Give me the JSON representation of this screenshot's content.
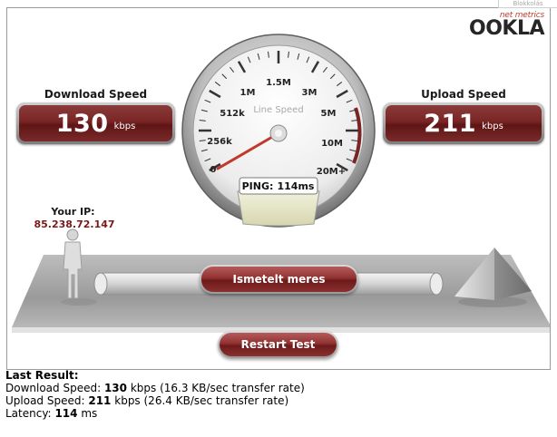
{
  "header": {
    "corner_link": "Blokkolás",
    "brand_top": "net metrics",
    "brand_main": "OOKLA"
  },
  "download": {
    "label": "Download Speed",
    "value": "130",
    "unit": "kbps"
  },
  "upload": {
    "label": "Upload Speed",
    "value": "211",
    "unit": "kbps"
  },
  "gauge": {
    "title": "Line Speed",
    "ticks": [
      "0",
      "256k",
      "512k",
      "1M",
      "1.5M",
      "3M",
      "5M",
      "10M",
      "20M+"
    ],
    "needle_value": "130 kbps",
    "ping_label": "PING:",
    "ping_value": "114ms"
  },
  "ip": {
    "label": "Your IP:",
    "value": "85.238.72.147"
  },
  "buttons": {
    "retest": "Ismetelt meres",
    "restart": "Restart Test"
  },
  "last_result": {
    "title": "Last Result:",
    "download_prefix": "Download Speed:",
    "download_value": "130",
    "download_suffix": "kbps (16.3 KB/sec transfer rate)",
    "upload_prefix": "Upload Speed:",
    "upload_value": "211",
    "upload_suffix": "kbps (26.4 KB/sec transfer rate)",
    "latency_prefix": "Latency:",
    "latency_value": "114",
    "latency_suffix": "ms"
  },
  "colors": {
    "accent_dark_red": "#7a2525",
    "needle": "#c0392b",
    "ip_text": "#7a1a1a"
  }
}
